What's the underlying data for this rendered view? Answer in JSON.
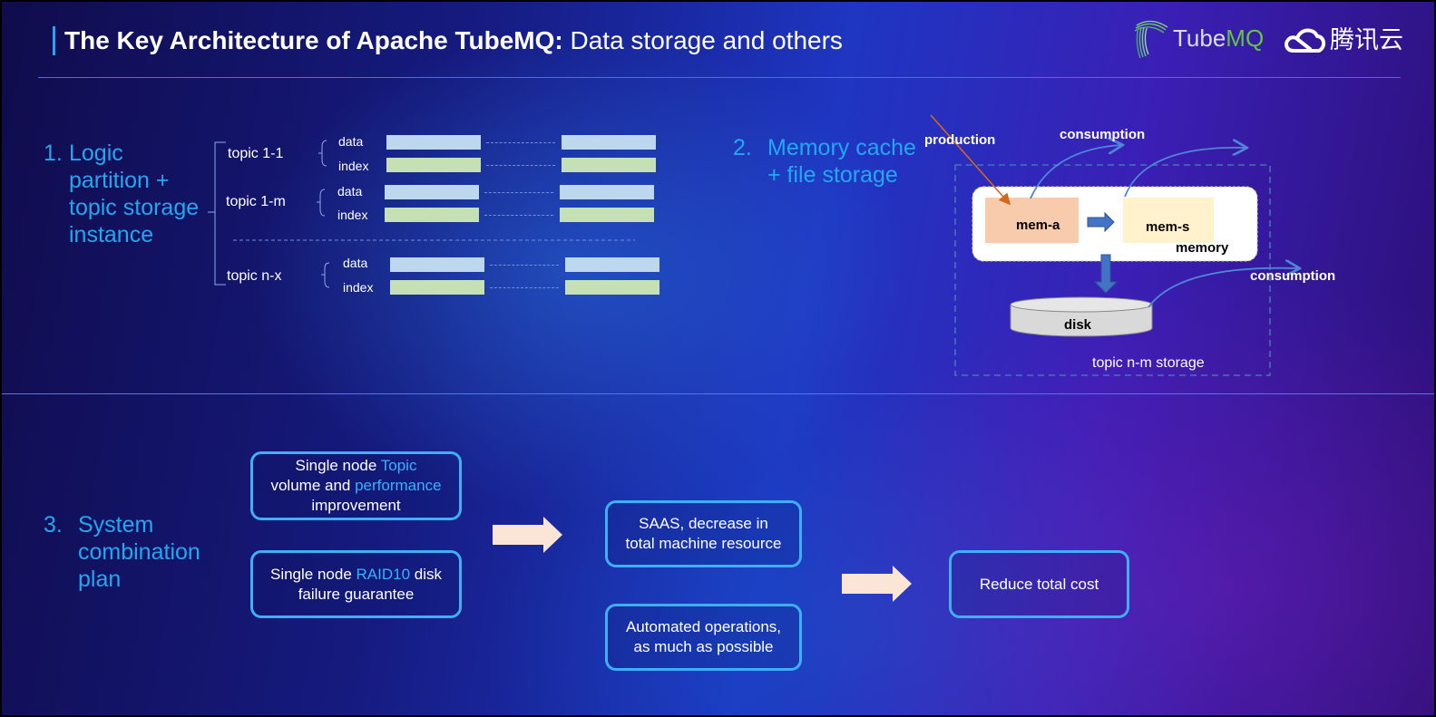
{
  "header": {
    "title_bold": "The Key Architecture of Apache TubeMQ:",
    "title_regular": " Data storage and others",
    "logo_tubemq_a": "Tube",
    "logo_tubemq_b": "MQ",
    "logo_tencent": "腾讯云",
    "accent_color": "#2ba3f5"
  },
  "section1": {
    "number": "1.",
    "title_lines": [
      "Logic",
      "partition +",
      "topic storage",
      "instance"
    ],
    "topics": [
      {
        "name": "topic 1-1",
        "rows": [
          "data",
          "index"
        ]
      },
      {
        "name": "topic 1-m",
        "rows": [
          "data",
          "index"
        ]
      },
      {
        "name": "topic n-x",
        "rows": [
          "data",
          "index"
        ]
      }
    ]
  },
  "section2": {
    "number": "2.",
    "title_lines": [
      "Memory cache",
      "+ file storage"
    ],
    "labels": {
      "production": "production",
      "consumption_1": "consumption",
      "consumption_2": "consumption",
      "mem_a": "mem-a",
      "mem_s": "mem-s",
      "memory": "memory",
      "disk": "disk",
      "storage": "topic n-m storage"
    }
  },
  "section3": {
    "number": "3.",
    "title_lines": [
      "System",
      "combination",
      "plan"
    ],
    "box1": {
      "t1": "Single node ",
      "h1": "Topic",
      "t2": "volume and ",
      "h2": "performance",
      "t3": "improvement"
    },
    "box2": {
      "t1": "Single node ",
      "h1": "RAID10",
      "t2": " disk",
      "t3": "failure guarantee"
    },
    "box3": {
      "l1": "SAAS, decrease in",
      "l2": "total machine resource"
    },
    "box4": {
      "l1": "Automated operations,",
      "l2": "as much as possible"
    },
    "box5": {
      "l1": "Reduce total cost"
    }
  }
}
